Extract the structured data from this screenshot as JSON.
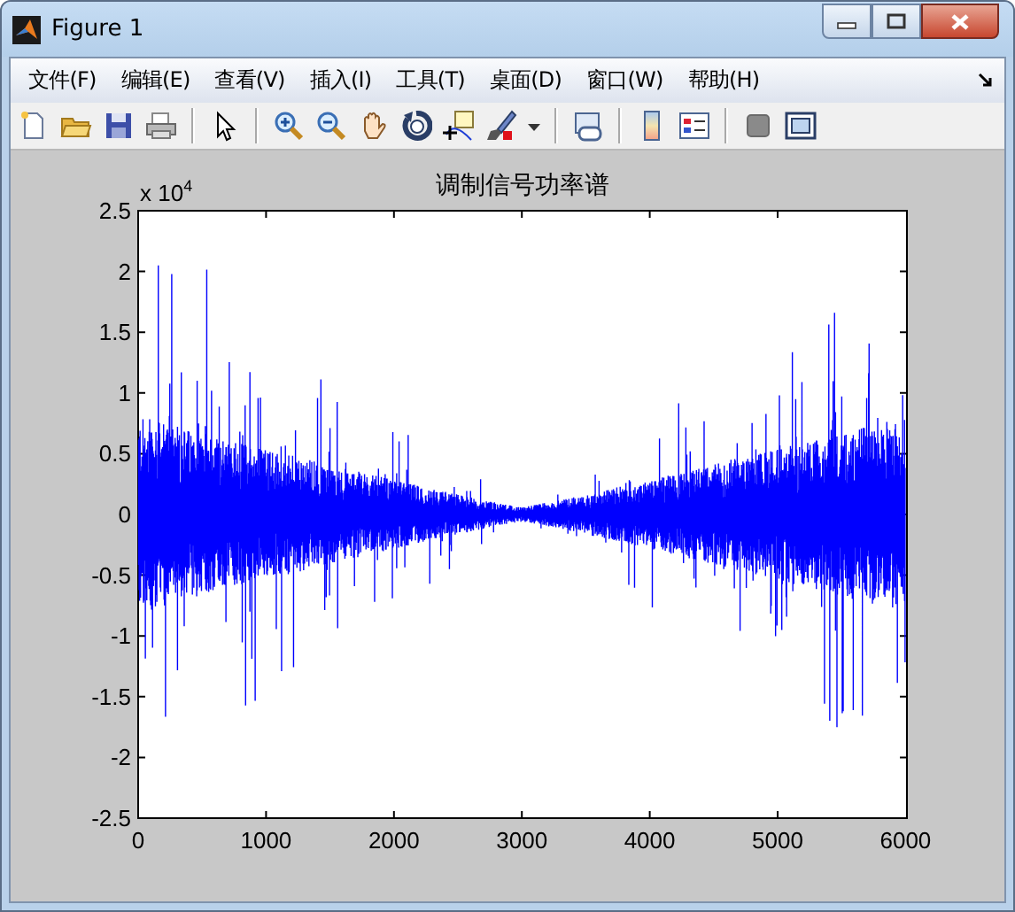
{
  "window": {
    "title": "Figure 1"
  },
  "menu": [
    {
      "label": "文件(F)"
    },
    {
      "label": "编辑(E)"
    },
    {
      "label": "查看(V)"
    },
    {
      "label": "插入(I)"
    },
    {
      "label": "工具(T)"
    },
    {
      "label": "桌面(D)"
    },
    {
      "label": "窗口(W)"
    },
    {
      "label": "帮助(H)"
    }
  ],
  "plot": {
    "title": "调制信号功率谱",
    "exponent_label": "x 10$^{4}$",
    "yticks": [
      "2.5",
      "2",
      "1.5",
      "1",
      "0.5",
      "0",
      "-0.5",
      "-1",
      "-1.5",
      "-2",
      "-2.5"
    ],
    "xticks": [
      "0",
      "1000",
      "2000",
      "3000",
      "4000",
      "5000",
      "6000"
    ]
  }
}
